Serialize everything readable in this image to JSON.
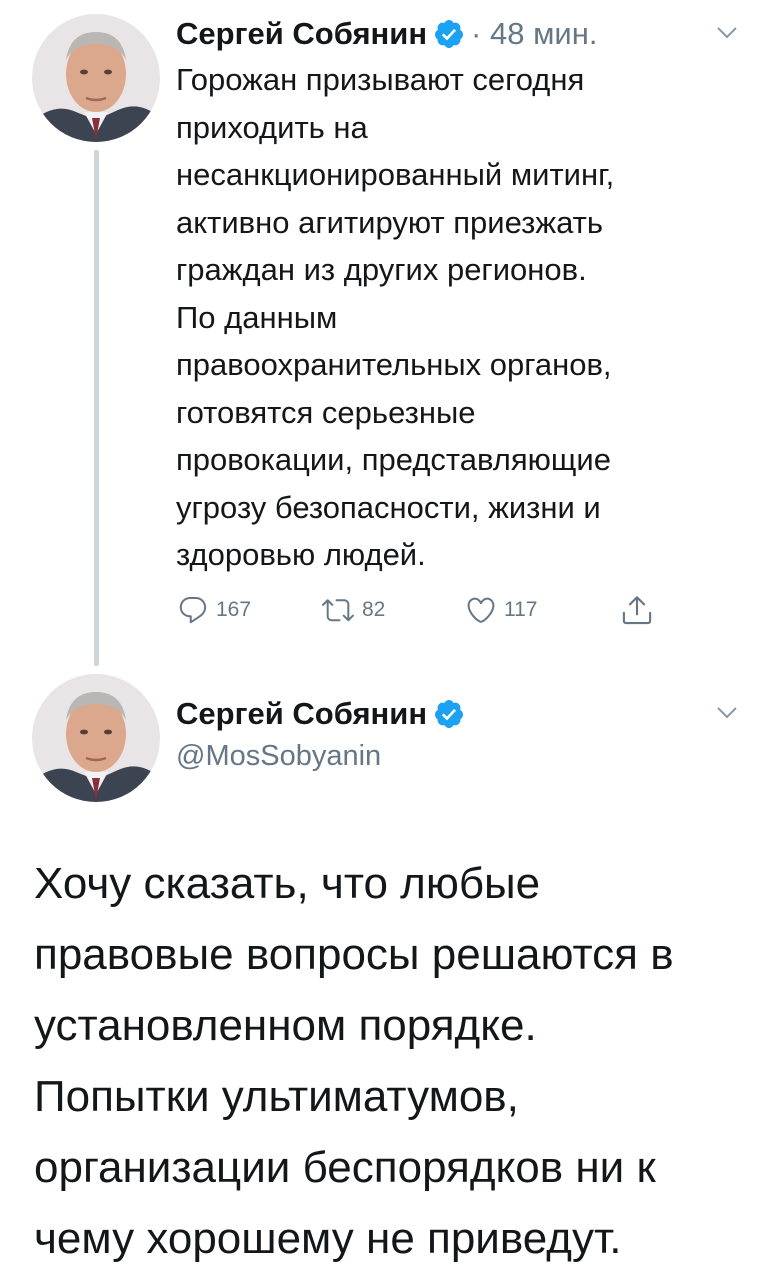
{
  "tweet1": {
    "author_name": "Сергей Собянин",
    "time": "· 48 мин.",
    "text_lines": [
      "Горожан призывают сегодня",
      "приходить на",
      "несанкционированный митинг,",
      "активно агитируют приезжать",
      "граждан из других регионов.",
      "По данным",
      "правоохранительных органов,",
      "готовятся серьезные",
      "провокации, представляющие",
      "угрозу безопасности, жизни и",
      "здоровью людей."
    ],
    "replies": "167",
    "retweets": "82",
    "likes": "117",
    "icons": {
      "verified": "verified-badge-icon",
      "chevron": "chevron-down-icon",
      "reply": "reply-icon",
      "retweet": "retweet-icon",
      "like": "heart-icon",
      "share": "share-icon"
    }
  },
  "tweet2": {
    "author_name": "Сергей Собянин",
    "handle": "@MosSobyanin",
    "text_lines": [
      "Хочу сказать, что любые",
      "правовые вопросы решаются в",
      "установленном порядке.",
      "Попытки ультиматумов,",
      "организации беспорядков ни к",
      "чему хорошему не приведут."
    ]
  },
  "colors": {
    "text": "#14171a",
    "secondary": "#657786",
    "verified": "#1da1f2",
    "thread_line": "#ccd6dd"
  }
}
